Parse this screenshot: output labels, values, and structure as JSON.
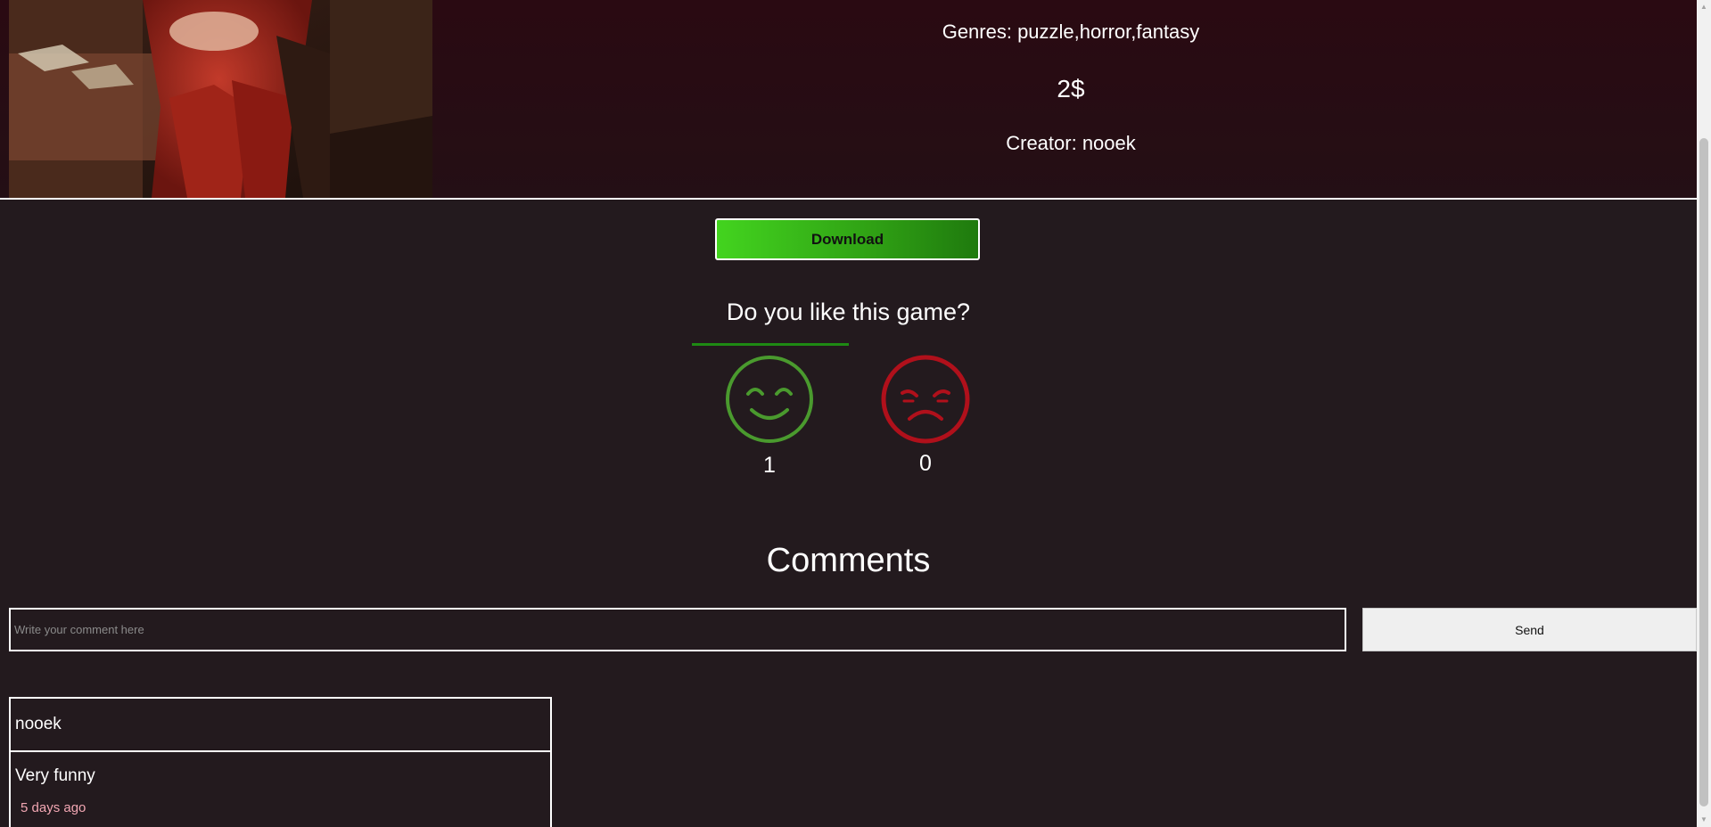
{
  "game": {
    "genres": "Genres: puzzle,horror,fantasy",
    "price": "2$",
    "creator": "Creator: nooek"
  },
  "actions": {
    "download_label": "Download"
  },
  "rating": {
    "question": "Do you like this game?",
    "like_count": "1",
    "dislike_count": "0",
    "like_color": "#4a9a2e",
    "dislike_color": "#b0101b"
  },
  "comments": {
    "title": "Comments",
    "input_placeholder": "Write your comment here",
    "send_label": "Send",
    "items": [
      {
        "author": "nooek",
        "text": "Very funny",
        "time": "5 days ago"
      }
    ]
  },
  "icons": {
    "like": "smiley-face-icon",
    "dislike": "frowning-face-icon",
    "scroll_up": "scroll-up-arrow-icon",
    "scroll_down": "scroll-down-arrow-icon"
  }
}
